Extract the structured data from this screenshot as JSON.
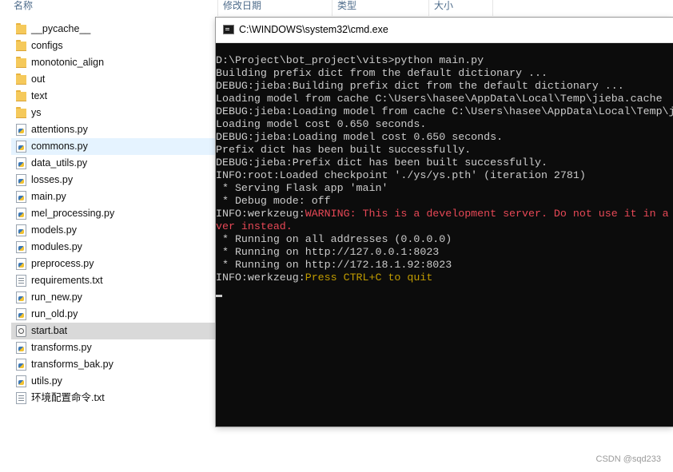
{
  "explorer": {
    "columns": {
      "name": "名称",
      "modified": "修改日期",
      "type": "类型",
      "size": "大小"
    },
    "files": [
      {
        "name": "__pycache__",
        "icon": "folder-icon"
      },
      {
        "name": "configs",
        "icon": "folder-icon"
      },
      {
        "name": "monotonic_align",
        "icon": "folder-icon"
      },
      {
        "name": "out",
        "icon": "folder-icon"
      },
      {
        "name": "text",
        "icon": "folder-icon"
      },
      {
        "name": "ys",
        "icon": "folder-icon"
      },
      {
        "name": "attentions.py",
        "icon": "python-file-icon"
      },
      {
        "name": "commons.py",
        "icon": "python-file-icon",
        "state": "hover"
      },
      {
        "name": "data_utils.py",
        "icon": "python-file-icon"
      },
      {
        "name": "losses.py",
        "icon": "python-file-icon"
      },
      {
        "name": "main.py",
        "icon": "python-file-icon"
      },
      {
        "name": "mel_processing.py",
        "icon": "python-file-icon"
      },
      {
        "name": "models.py",
        "icon": "python-file-icon"
      },
      {
        "name": "modules.py",
        "icon": "python-file-icon"
      },
      {
        "name": "preprocess.py",
        "icon": "python-file-icon"
      },
      {
        "name": "requirements.txt",
        "icon": "text-file-icon"
      },
      {
        "name": "run_new.py",
        "icon": "python-file-icon"
      },
      {
        "name": "run_old.py",
        "icon": "python-file-icon"
      },
      {
        "name": "start.bat",
        "icon": "batch-file-icon",
        "state": "selected"
      },
      {
        "name": "transforms.py",
        "icon": "python-file-icon"
      },
      {
        "name": "transforms_bak.py",
        "icon": "python-file-icon"
      },
      {
        "name": "utils.py",
        "icon": "python-file-icon"
      },
      {
        "name": "环境配置命令.txt",
        "icon": "text-file-icon"
      }
    ]
  },
  "cmd": {
    "title": "C:\\WINDOWS\\system32\\cmd.exe",
    "lines": [
      [
        {
          "t": "D:\\Project\\bot_project\\vits>python main.py"
        }
      ],
      [
        {
          "t": "Building prefix dict from the default dictionary ..."
        }
      ],
      [
        {
          "t": "DEBUG:jieba:Building prefix dict from the default dictionary ..."
        }
      ],
      [
        {
          "t": "Loading model from cache C:\\Users\\hasee\\AppData\\Local\\Temp\\jieba.cache"
        }
      ],
      [
        {
          "t": "DEBUG:jieba:Loading model from cache C:\\Users\\hasee\\AppData\\Local\\Temp\\jieba.cache"
        }
      ],
      [
        {
          "t": "Loading model cost 0.650 seconds."
        }
      ],
      [
        {
          "t": "DEBUG:jieba:Loading model cost 0.650 seconds."
        }
      ],
      [
        {
          "t": "Prefix dict has been built successfully."
        }
      ],
      [
        {
          "t": "DEBUG:jieba:Prefix dict has been built successfully."
        }
      ],
      [
        {
          "t": "INFO:root:Loaded checkpoint './ys/ys.pth' (iteration 2781)"
        }
      ],
      [
        {
          "t": " * Serving Flask app 'main'"
        }
      ],
      [
        {
          "t": " * Debug mode: off"
        }
      ],
      [
        {
          "t": "INFO:werkzeug:"
        },
        {
          "t": "WARNING: This is a development server. Do not use it in a production deployment. Use a production WSGI ser",
          "c": "warn"
        }
      ],
      [
        {
          "t": "ver instead.",
          "c": "warn"
        }
      ],
      [
        {
          "t": " * Running on all addresses (0.0.0.0)"
        }
      ],
      [
        {
          "t": " * Running on http://127.0.0.1:8023"
        }
      ],
      [
        {
          "t": " * Running on http://172.18.1.92:8023"
        }
      ],
      [
        {
          "t": "INFO:werkzeug:"
        },
        {
          "t": "Press CTRL+C to quit",
          "c": "yel"
        }
      ],
      [
        {
          "t": ""
        }
      ]
    ]
  },
  "watermark": "CSDN @sqd233",
  "colors": {
    "console_bg": "#0c0c0c",
    "console_text": "#cccccc",
    "warning": "#e74856",
    "hint": "#c19c00",
    "selected_row": "#d9d9d9",
    "hover_row": "#e5f3ff"
  }
}
